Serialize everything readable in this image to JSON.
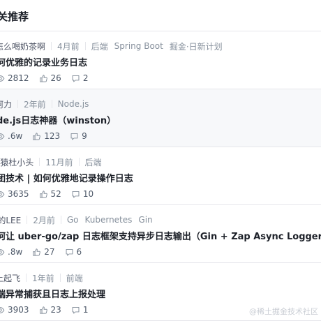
{
  "header": {
    "title": "关推荐"
  },
  "articles": [
    {
      "author": "怎么喝奶茶啊",
      "time": "4月前",
      "tags": [
        "后端",
        "Spring Boot",
        "掘金·日新计划"
      ],
      "title": "何优雅的记录业务日志",
      "views": "2812",
      "likes": "26",
      "comments": "2"
    },
    {
      "author": "阿力",
      "time": "2年前",
      "tags": [
        "Node.js"
      ],
      "title": "de.js日志神器（winston）",
      "views": ".6w",
      "likes": "123",
      "comments": "9"
    },
    {
      "author": "P猿杜小头",
      "time": "11月前",
      "tags": [
        "后端"
      ],
      "title": "团技术 | 如何优雅地记录操作日志",
      "views": "3635",
      "likes": "52",
      "comments": "10"
    },
    {
      "author": "i的LEE",
      "time": "2月前",
      "tags": [
        "Go",
        "Kubernetes",
        "Gin"
      ],
      "title": "何让 uber-go/zap 日志框架支持异步日志输出（Gin + Zap Async Logger）",
      "views": ".8w",
      "likes": "27",
      "comments": "6"
    },
    {
      "author": "上起飞",
      "time": "1年前",
      "tags": [
        "前端"
      ],
      "title": "端异常捕获且日志上报处理",
      "views": "3903",
      "likes": "23",
      "comments": "1"
    }
  ],
  "watermark": "@稀土掘金技术社区"
}
